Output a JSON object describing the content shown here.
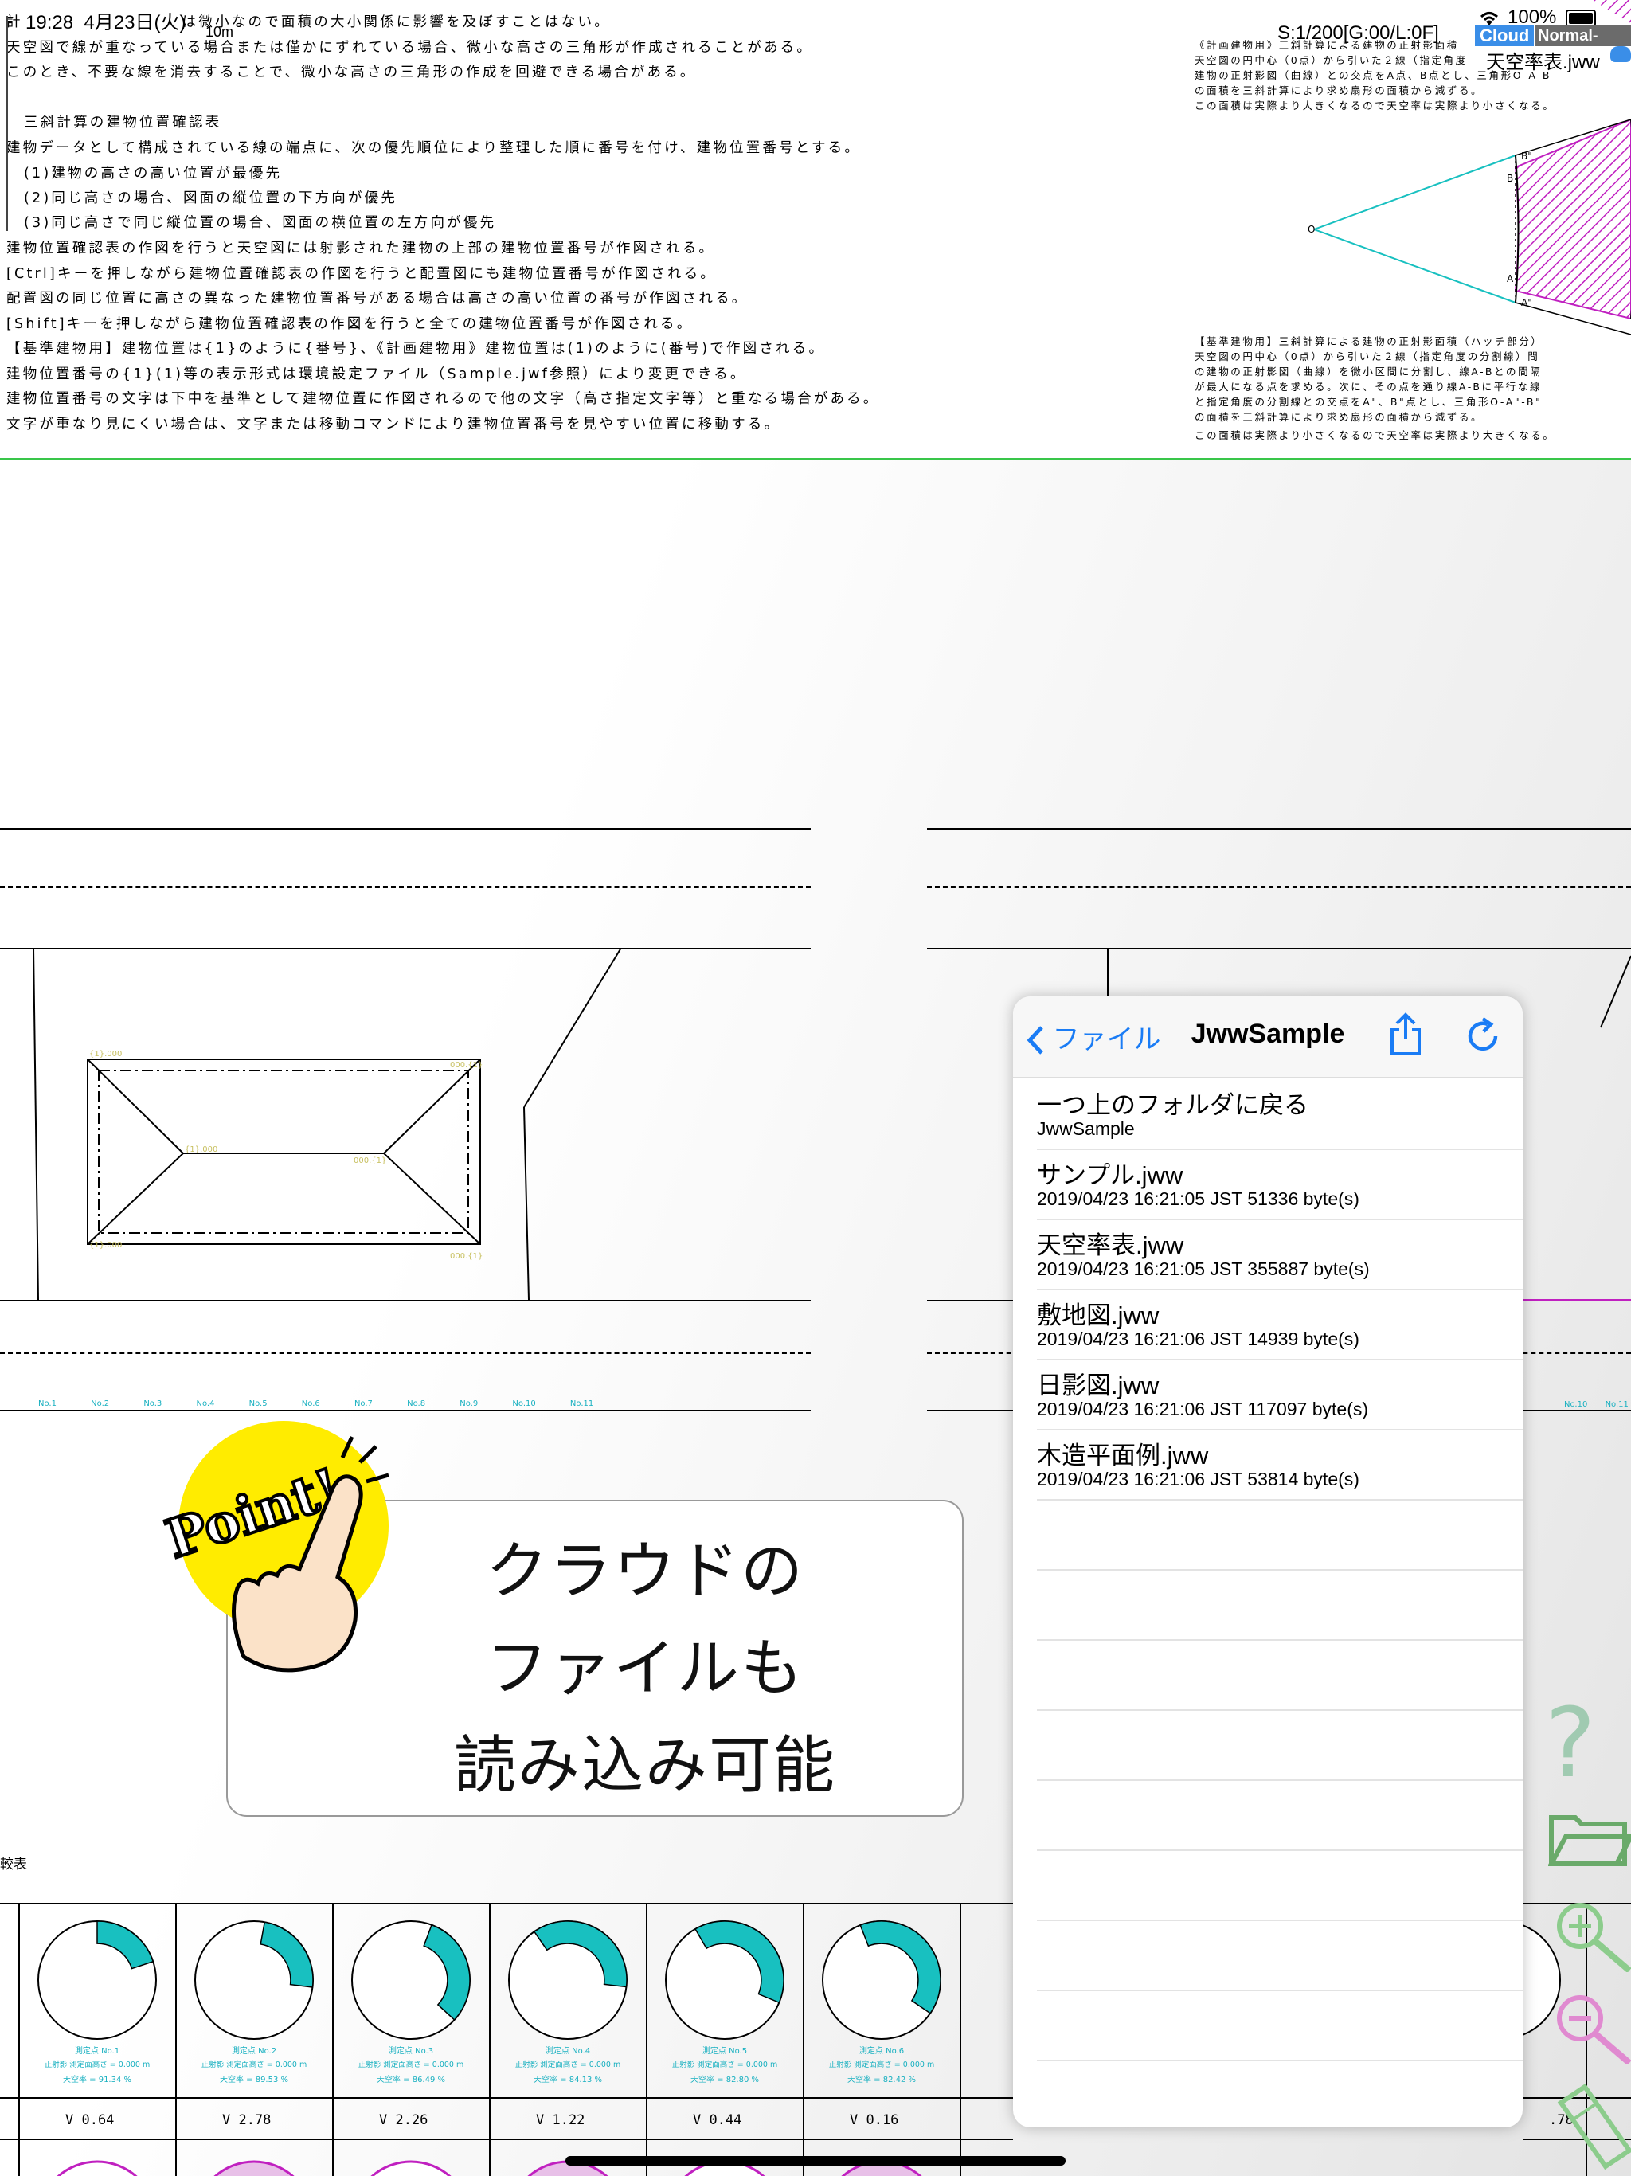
{
  "status_bar": {
    "time": "19:28",
    "date": "4月23日(火)",
    "scale_label": "10m",
    "scale_info": "S:1/200[G:00/L:0F]",
    "battery": "100%",
    "cloud_badge": "Cloud",
    "mode_badge": "Normal-Mode",
    "file_name": "天空率表.jww"
  },
  "document": {
    "top_line_a": "計",
    "top_line_b": "は微小なので面積の大小関係に影響を及ぼすことはない。",
    "lines": [
      "天空図で線が重なっている場合または僅かにずれている場合、微小な高さの三角形が作成されることがある。",
      "このとき、不要な線を消去することで、微小な高さの三角形の作成を回避できる場合がある。",
      "三斜計算の建物位置確認表",
      "建物データとして構成されている線の端点に、次の優先順位により整理した順に番号を付け、建物位置番号とする。",
      "(1)建物の高さの高い位置が最優先",
      "(2)同じ高さの場合、図面の縦位置の下方向が優先",
      "(3)同じ高さで同じ縦位置の場合、図面の横位置の左方向が優先",
      "建物位置確認表の作図を行うと天空図には射影された建物の上部の建物位置番号が作図される。",
      "[Ctrl]キーを押しながら建物位置確認表の作図を行うと配置図にも建物位置番号が作図される。",
      "配置図の同じ位置に高さの異なった建物位置番号がある場合は高さの高い位置の番号が作図される。",
      "[Shift]キーを押しながら建物位置確認表の作図を行うと全ての建物位置番号が作図される。",
      "【基準建物用】建物位置は{1}のように{番号}、《計画建物用》建物位置は(1)のように(番号)で作図される。",
      "建物位置番号の{1}(1)等の表示形式は環境設定ファイル（Sample.jwf参照）により変更できる。",
      "建物位置番号の文字は下中を基準として建物位置に作図されるので他の文字（高さ指定文字等）と重なる場合がある。",
      "文字が重なり見にくい場合は、文字または移動コマンドにより建物位置番号を見やすい位置に移動する。"
    ],
    "right_notes_top": [
      "《計画建物用》三斜計算による建物の正射影面積",
      "天空図の円中心（0点）から引いた２線（指定角度",
      "建物の正射影図（曲線）との交点をA点、B点とし、三角形O-A-B",
      "の面積を三斜計算により求め扇形の面積から減ずる。",
      "この面積は実際より大きくなるので天空率は実際より小さくなる。"
    ],
    "right_notes_bottom": [
      "【基準建物用】三斜計算による建物の正射影面積（ハッチ部分）",
      "天空図の円中心（0点）から引いた２線（指定角度の分割線）間",
      "の建物の正射影図（曲線）を微小区間に分割し、線A-Bとの間隔",
      "が最大になる点を求める。次に、その点を通り線A-Bに平行な線",
      "と指定角度の分割線との交点をA\"、B\"点とし、三角形O-A\"-B\"",
      "の面積を三斜計算により求め扇形の面積から減ずる。",
      "この面積は実際より小さくなるので天空率は実際より大きくなる。"
    ],
    "diagram_labels": {
      "o": "O",
      "a": "A",
      "b": "B",
      "a2": "A\"",
      "b2": "B\""
    }
  },
  "point_callout": {
    "badge": "Point!",
    "line1": "クラウドの",
    "line2": "ファイルも",
    "line3": "読み込み可能"
  },
  "file_panel": {
    "back_label": "ファイル",
    "title": "JwwSample",
    "items": [
      {
        "name": "一つ上のフォルダに戻る",
        "meta": "JwwSample"
      },
      {
        "name": "サンプル.jww",
        "meta": "2019/04/23 16:21:05 JST 51336 byte(s)"
      },
      {
        "name": "天空率表.jww",
        "meta": "2019/04/23 16:21:05 JST 355887 byte(s)"
      },
      {
        "name": "敷地図.jww",
        "meta": "2019/04/23 16:21:06 JST 14939 byte(s)"
      },
      {
        "name": "日影図.jww",
        "meta": "2019/04/23 16:21:06 JST 117097 byte(s)"
      },
      {
        "name": "木造平面例.jww",
        "meta": "2019/04/23 16:21:06 JST 53814 byte(s)"
      }
    ]
  },
  "table": {
    "caption": "較表",
    "gauges": [
      {
        "label": "測定点 No.1",
        "line2": "正射影  測定面高さ = 0.000 m",
        "line3": "天空率 = 91.34 %",
        "value": "V    0.64"
      },
      {
        "label": "測定点 No.2",
        "line2": "正射影  測定面高さ = 0.000 m",
        "line3": "天空率 = 89.53 %",
        "value": "V    2.78"
      },
      {
        "label": "測定点 No.3",
        "line2": "正射影  測定面高さ = 0.000 m",
        "line3": "天空率 = 86.49 %",
        "value": "V    2.26"
      },
      {
        "label": "測定点 No.4",
        "line2": "正射影  測定面高さ = 0.000 m",
        "line3": "天空率 = 84.13 %",
        "value": "V    1.22"
      },
      {
        "label": "測定点 No.5",
        "line2": "正射影  測定面高さ = 0.000 m",
        "line3": "天空率 = 82.80 %",
        "value": "V    0.44"
      },
      {
        "label": "測定点 No.6",
        "line2": "正射影  測定面高さ = 0.000 m",
        "line3": "天空率 = 82.42 %",
        "value": "V    0.16"
      }
    ],
    "right_value": ".78"
  },
  "drawing_labels": [
    "No.1",
    "No.2",
    "No.3",
    "No.4",
    "No.5",
    "No.6",
    "No.7",
    "No.8",
    "No.9",
    "No.10",
    "No.11"
  ],
  "colors": {
    "accent": "#1a7cf5",
    "cyan": "#18c0c0",
    "green_line": "#39c64a",
    "magenta": "#c020c0",
    "tool_green": "#7ab87a",
    "tool_pink": "#e08ad0"
  }
}
